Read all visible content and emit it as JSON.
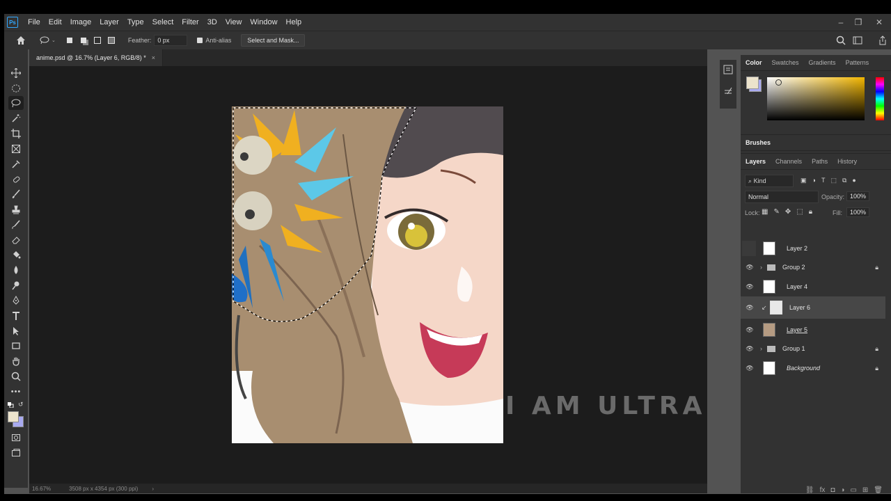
{
  "app": {
    "logo": "Ps"
  },
  "menu": [
    "File",
    "Edit",
    "Image",
    "Layer",
    "Type",
    "Select",
    "Filter",
    "3D",
    "View",
    "Window",
    "Help"
  ],
  "options": {
    "feather_label": "Feather:",
    "feather_value": "0 px",
    "antialias_label": "Anti-alias",
    "select_mask_label": "Select and Mask..."
  },
  "document": {
    "tab_title": "anime.psd @ 16.7% (Layer 6, RGB/8) *",
    "close": "×"
  },
  "status": {
    "zoom": "16.67%",
    "doc_info": "3508 px x 4354 px (300 ppi)",
    "arrow": "›"
  },
  "watermark": "I AM ULTRA",
  "panels": {
    "color_tabs": [
      "Color",
      "Swatches",
      "Gradients",
      "Patterns"
    ],
    "brushes_label": "Brushes",
    "layer_tabs": [
      "Layers",
      "Channels",
      "Paths",
      "History"
    ],
    "filter_kind": "Kind",
    "blend_mode": "Normal",
    "opacity_label": "Opacity:",
    "opacity_value": "100%",
    "lock_label": "Lock:",
    "fill_label": "Fill:",
    "fill_value": "100%",
    "layers": [
      {
        "name": "Layer 2"
      },
      {
        "name": "Group 2"
      },
      {
        "name": "Layer 4"
      },
      {
        "name": "Layer 6"
      },
      {
        "name": "Layer 5"
      },
      {
        "name": "Group 1"
      },
      {
        "name": "Background"
      }
    ]
  },
  "colors": {
    "foreground": "#ece3cc",
    "background": "#a9aaf0",
    "accent_hue": "#f2b600"
  }
}
